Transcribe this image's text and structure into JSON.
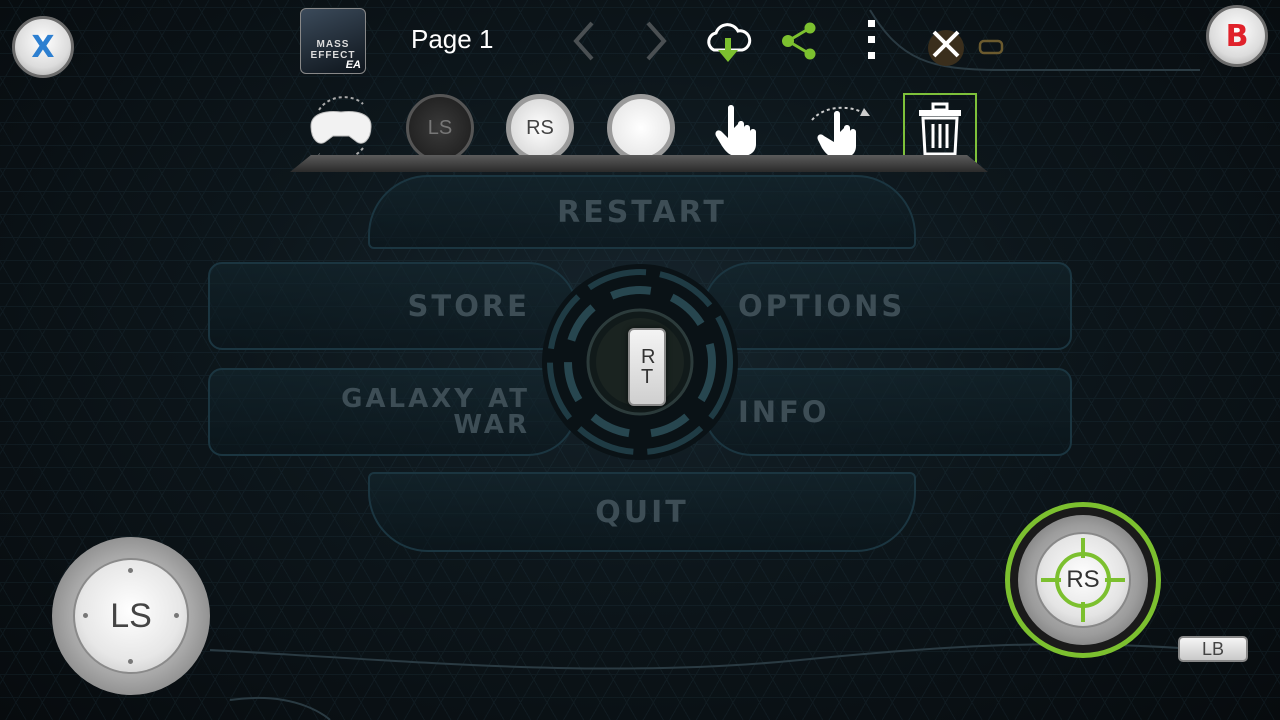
{
  "corner_buttons": {
    "x_label": "X",
    "b_label": "B"
  },
  "top_bar": {
    "app_thumb_title": "MASS EFFECT",
    "app_thumb_publisher": "EA",
    "page_label": "Page 1",
    "icons": [
      "chevron-left-icon",
      "chevron-right-icon",
      "cloud-download-icon",
      "share-icon",
      "more-vert-icon",
      "close-icon",
      "settings-gear-icon",
      "toggle-icon"
    ]
  },
  "toolbar": {
    "ls_label": "LS",
    "rs_label": "RS",
    "tools": [
      "rotate-controller-icon",
      "ls-stick-tool",
      "rs-stick-tool",
      "blank-button-tool",
      "tap-gesture-icon",
      "swipe-gesture-icon",
      "trash-icon"
    ]
  },
  "menu": {
    "restart": "RESTART",
    "store": "STORE",
    "options": "OPTIONS",
    "galaxy_at_war": "GALAXY AT WAR",
    "info": "INFO",
    "quit": "QUIT",
    "center_key": "RT"
  },
  "controls": {
    "left_stick": "LS",
    "right_stick": "RS",
    "lb_key": "LB"
  },
  "colors": {
    "accent_green": "#7cc02f",
    "x_blue": "#2d7fd0",
    "b_red": "#e0222b",
    "menu_text": "#3d4d55"
  }
}
